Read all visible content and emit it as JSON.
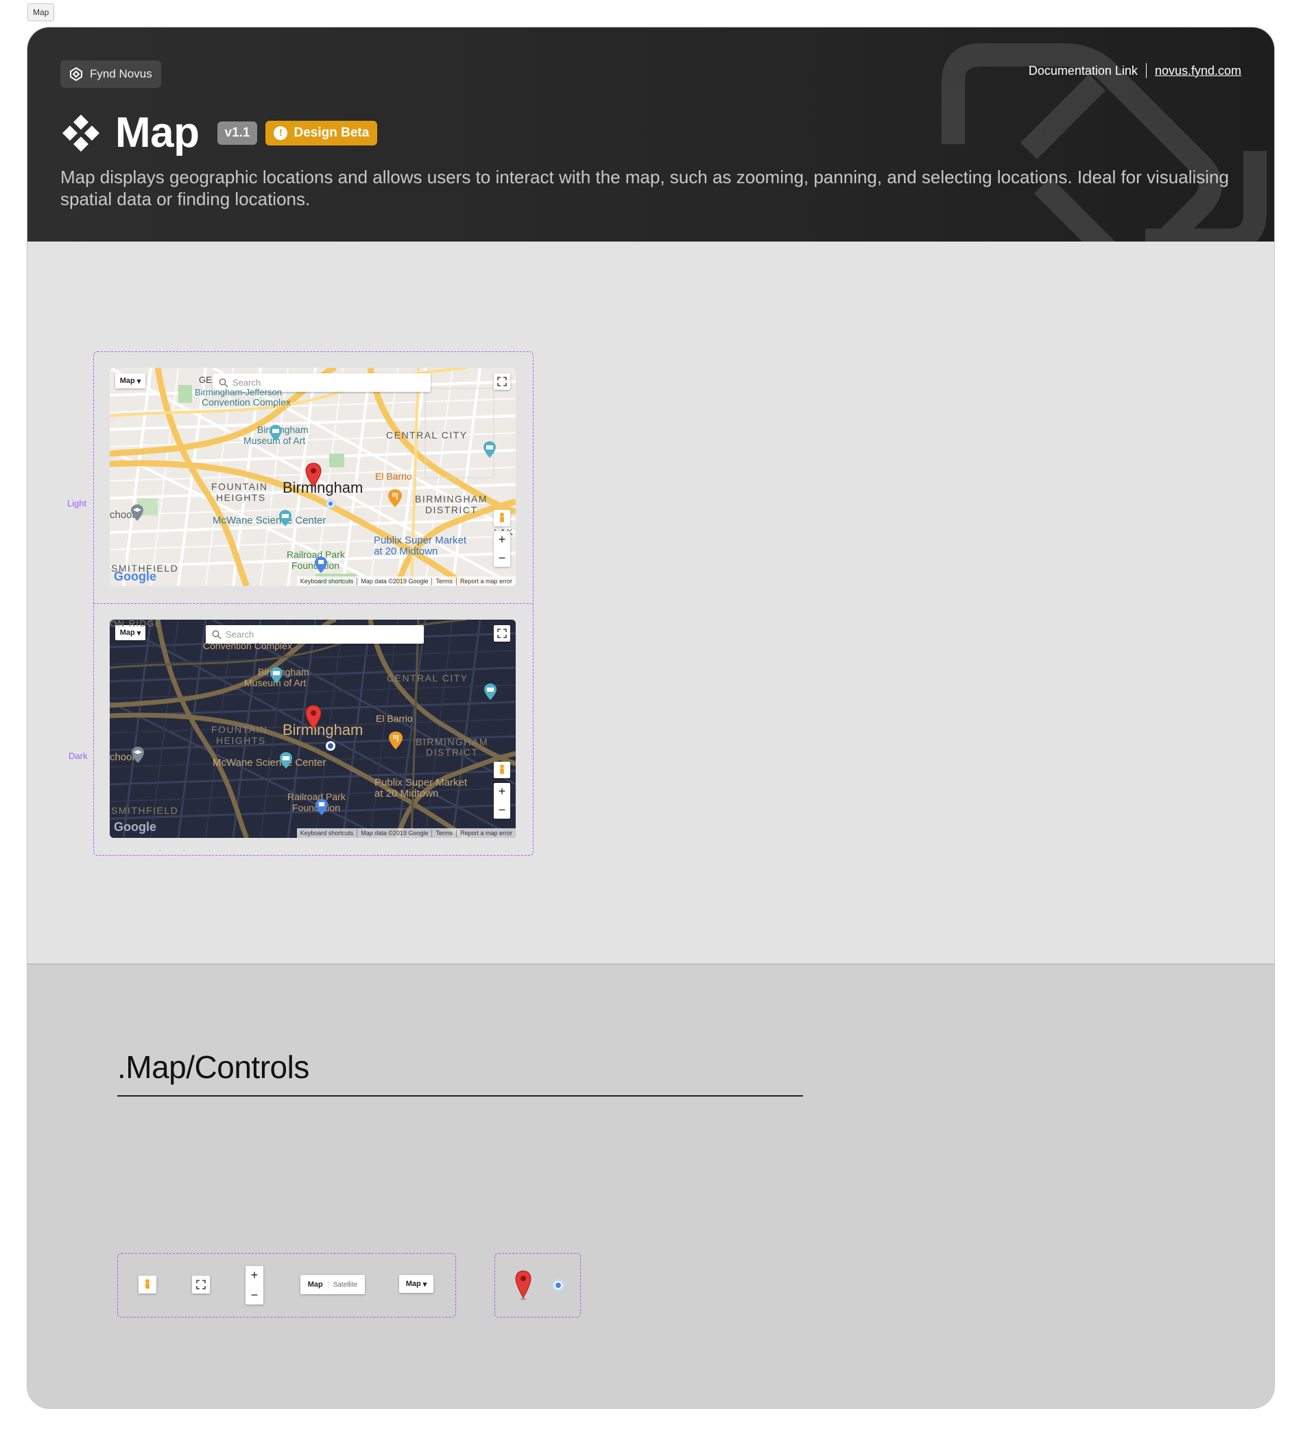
{
  "page_tag": "Map",
  "header": {
    "brand": "Fynd Novus",
    "doc_link_label": "Documentation Link",
    "doc_link_url": "novus.fynd.com",
    "title": "Map",
    "version": "v1.1",
    "status": "Design Beta",
    "description": "Map displays geographic locations and allows users to interact with the map, such as zooming, panning, and selecting locations. Ideal for visualising spatial data or finding locations."
  },
  "colors": {
    "header_bg": "#262626",
    "beta_badge": "#e09c12",
    "variant_outline": "#9b63f5",
    "light_section_bg": "#e3e3e3",
    "controls_section_bg": "#d0d0d0"
  },
  "variants": [
    {
      "label": "Light",
      "map": {
        "type_button": "Map",
        "search_placeholder": "Search",
        "labels": {
          "north_edge": "GE",
          "convention": "Convention Complex",
          "convention_top": "Birmingham-Jefferson",
          "museum_1": "Birmingham",
          "museum_2": "Museum of Art",
          "central_city": "CENTRAL CITY",
          "fountain_1": "FOUNTAIN",
          "fountain_2": "HEIGHTS",
          "city": "Birmingham",
          "el_barrio": "El Barrio",
          "district_1": "BIRMINGHAM",
          "district_2": "DISTRICT",
          "school": "chool",
          "mcwane": "McWane Science Center",
          "publix_1": "Publix Super Market",
          "publix_2": "at 20 Midtown",
          "railroad_1": "Railroad Park",
          "railroad_2": "Foundation",
          "smithfield": "SMITHFIELD",
          "lak": "LAK",
          "street": "9th St N"
        },
        "footer": [
          "Keyboard shortcuts",
          "Map data ©2019 Google",
          "Terms",
          "Report a map error"
        ],
        "logo": "Google"
      }
    },
    {
      "label": "Dark",
      "map": {
        "type_button": "Map",
        "search_placeholder": "Search",
        "labels": {
          "north_edge": "ON RIDGE",
          "convention": "Convention Complex",
          "museum_1": "Birmingham",
          "museum_2": "Museum of Art",
          "central_city": "CENTRAL CITY",
          "fountain_1": "FOUNTAIN",
          "fountain_2": "HEIGHTS",
          "city": "Birmingham",
          "el_barrio": "El Barrio",
          "district_1": "BIRMINGHAM",
          "district_2": "DISTRICT",
          "school": "chool",
          "mcwane": "McWane Science Center",
          "publix_1": "Publix Super Market",
          "publix_2": "at 20 Midtown",
          "railroad_1": "Railroad Park",
          "railroad_2": "Foundation",
          "smithfield": "SMITHFIELD",
          "street": "9th St N"
        },
        "footer": [
          "Keyboard shortcuts",
          "Map data ©2019 Google",
          "Terms",
          "Report a map error"
        ],
        "logo": "Google"
      }
    }
  ],
  "controls_section": {
    "title": ".Map/Controls",
    "zoom_in": "+",
    "zoom_out": "−",
    "map_toggle": "Map",
    "satellite_toggle": "Satellite",
    "type_dropdown": "Map",
    "icons": [
      "pegman-icon",
      "fullscreen-icon",
      "zoom-control",
      "map-type-toggle",
      "map-type-dropdown",
      "location-pin-icon",
      "current-location-dot-icon"
    ]
  }
}
